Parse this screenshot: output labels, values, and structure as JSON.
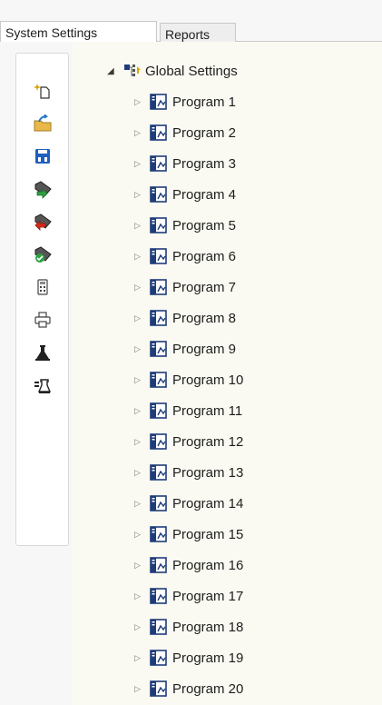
{
  "tabs": [
    {
      "label": "System Settings",
      "active": true
    },
    {
      "label": "Reports",
      "active": false
    }
  ],
  "toolbar": {
    "tools": [
      {
        "name": "new-icon"
      },
      {
        "name": "open-folder-icon"
      },
      {
        "name": "save-icon"
      },
      {
        "name": "import-icon"
      },
      {
        "name": "export-icon"
      },
      {
        "name": "verify-icon"
      },
      {
        "name": "calculator-icon"
      },
      {
        "name": "print-icon"
      },
      {
        "name": "flask-icon"
      },
      {
        "name": "test-tube-icon"
      }
    ]
  },
  "tree": {
    "root_label": "Global Settings",
    "programs": [
      "Program 1",
      "Program 2",
      "Program 3",
      "Program 4",
      "Program 5",
      "Program 6",
      "Program 7",
      "Program 8",
      "Program 9",
      "Program 10",
      "Program 11",
      "Program 12",
      "Program 13",
      "Program 14",
      "Program 15",
      "Program 16",
      "Program 17",
      "Program 18",
      "Program 19",
      "Program 20"
    ]
  }
}
